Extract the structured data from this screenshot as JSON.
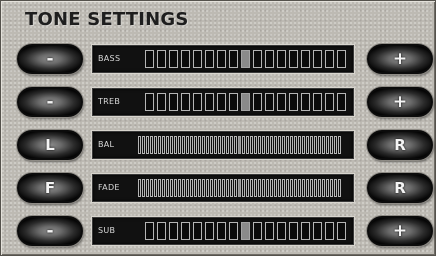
{
  "header": {
    "title": "TONE SETTINGS"
  },
  "rows": [
    {
      "label": "BASS",
      "left_button": "-",
      "right_button": "+",
      "segments": 17,
      "level_index": 8,
      "scale": "coarse"
    },
    {
      "label": "TREB",
      "left_button": "-",
      "right_button": "+",
      "segments": 17,
      "level_index": 8,
      "scale": "coarse"
    },
    {
      "label": "BAL",
      "left_button": "L",
      "right_button": "R",
      "segments": 51,
      "level_index": 25,
      "scale": "fine"
    },
    {
      "label": "FADE",
      "left_button": "F",
      "right_button": "R",
      "segments": 51,
      "level_index": 25,
      "scale": "fine"
    },
    {
      "label": "SUB",
      "left_button": "-",
      "right_button": "+",
      "segments": 17,
      "level_index": 8,
      "scale": "coarse"
    }
  ],
  "colors": {
    "panel": "#bdbab3",
    "display_bg": "#111111",
    "segment_outline": "#b5b5b5",
    "segment_active": "#8a8a8a"
  }
}
